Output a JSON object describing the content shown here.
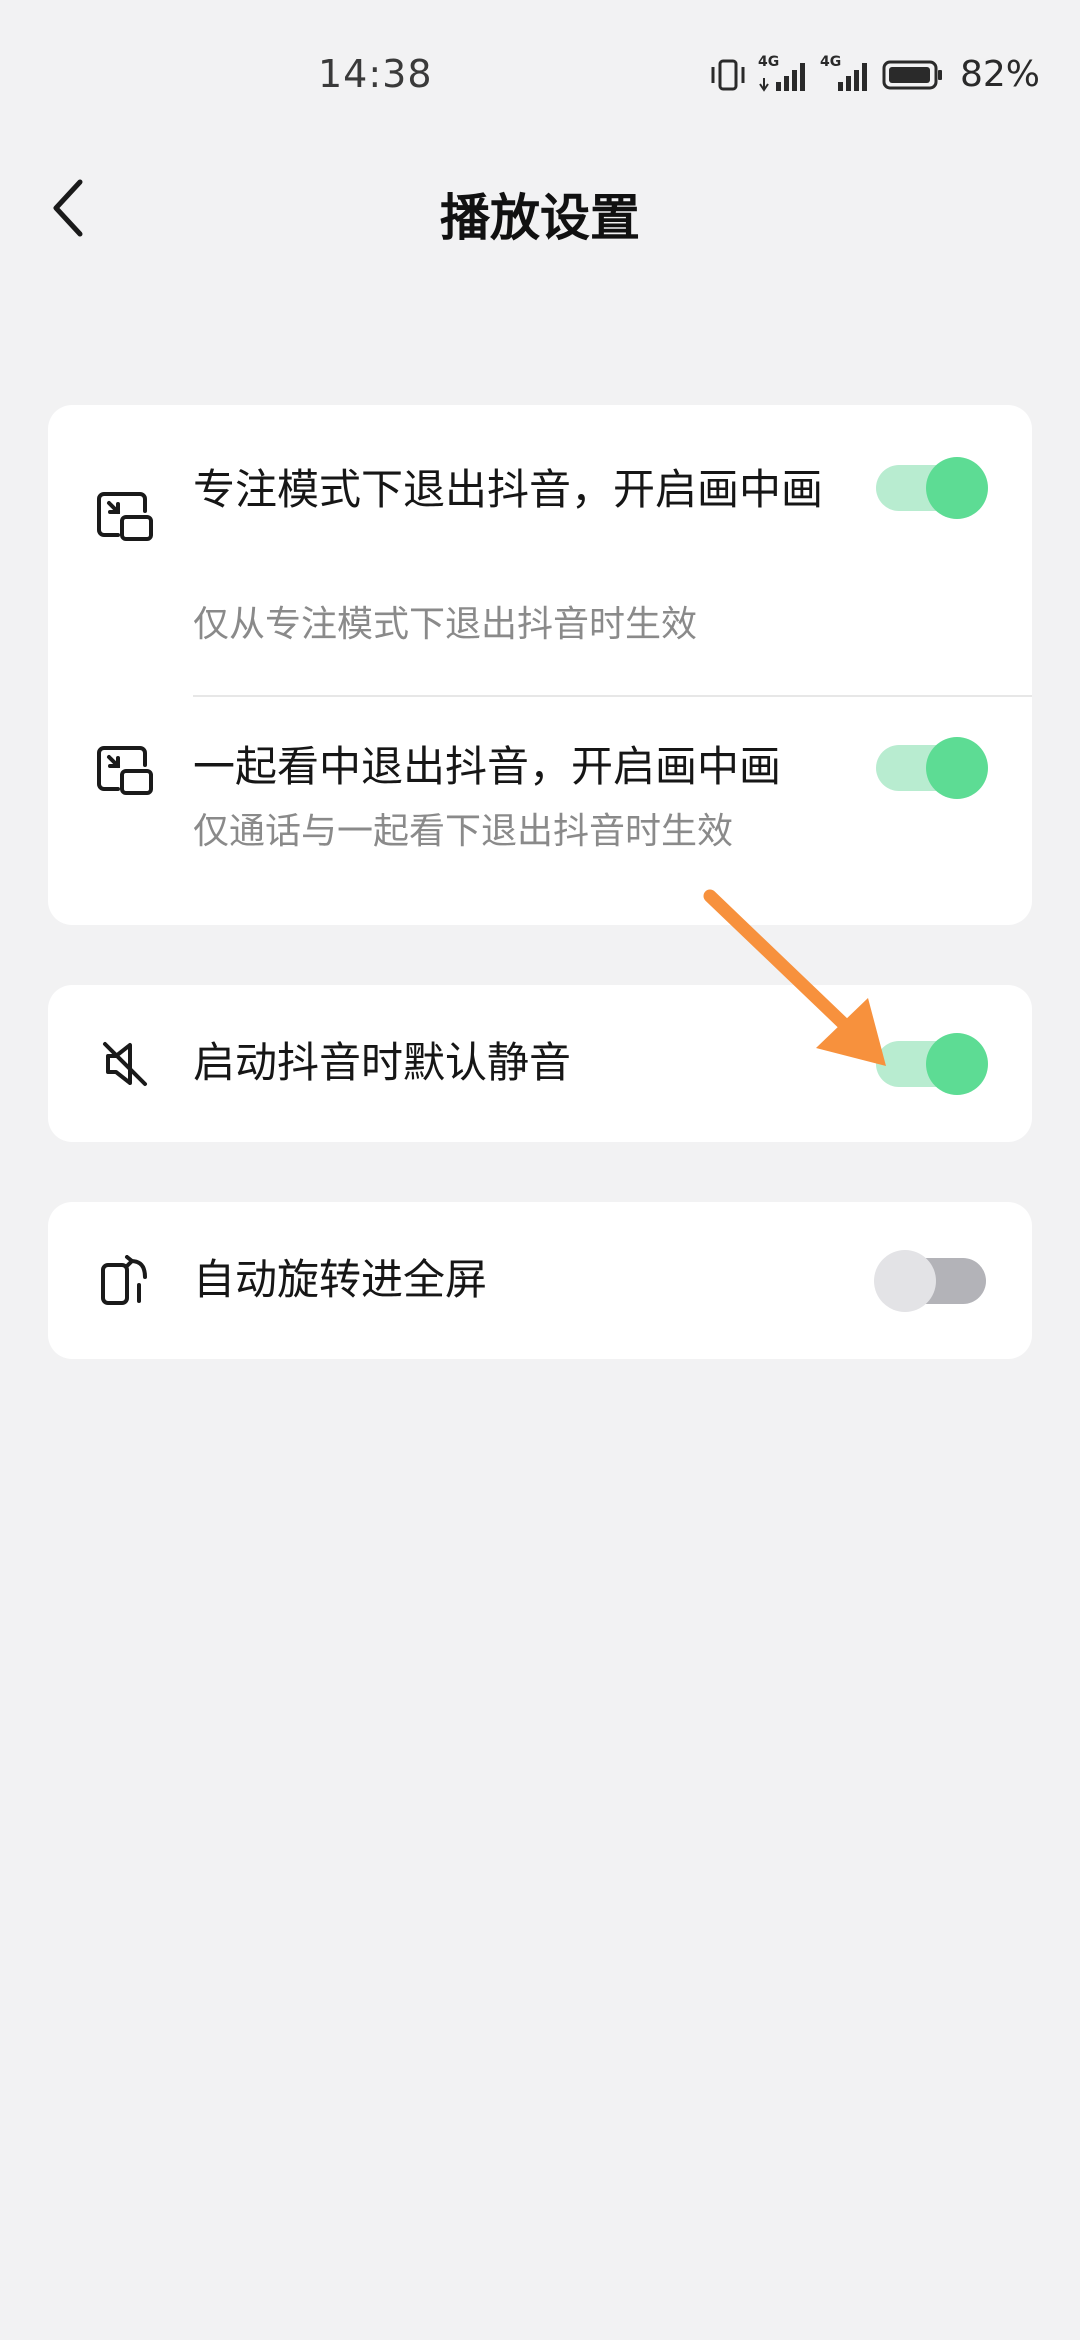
{
  "status_bar": {
    "time": "14:38",
    "battery_percent": "82%",
    "network_label_1": "4G",
    "network_label_2": "4G",
    "icons": [
      "vibrate-icon",
      "signal-4g-icon",
      "signal-4g-icon",
      "battery-icon"
    ]
  },
  "header": {
    "title": "播放设置",
    "back_icon": "chevron-left-icon"
  },
  "settings": {
    "pip_focus": {
      "title": "专注模式下退出抖音，开启画中画",
      "subtitle": "仅从专注模式下退出抖音时生效",
      "enabled": true,
      "icon": "picture-in-picture-icon"
    },
    "pip_watch_together": {
      "title": "一起看中退出抖音，开启画中画",
      "subtitle": "仅通话与一起看下退出抖音时生效",
      "enabled": true,
      "icon": "picture-in-picture-icon"
    },
    "mute_on_launch": {
      "title": "启动抖音时默认静音",
      "enabled": true,
      "icon": "mute-icon"
    },
    "auto_rotate": {
      "title": "自动旋转进全屏",
      "enabled": false,
      "icon": "rotate-screen-icon"
    }
  },
  "colors": {
    "toggle_on_track": "#b8ecd0",
    "toggle_on_knob": "#5ddc94",
    "toggle_off_track": "#b3b3b8",
    "toggle_off_knob": "#e3e3e6",
    "annotation_arrow": "#f7913d",
    "background": "#f2f2f3"
  }
}
